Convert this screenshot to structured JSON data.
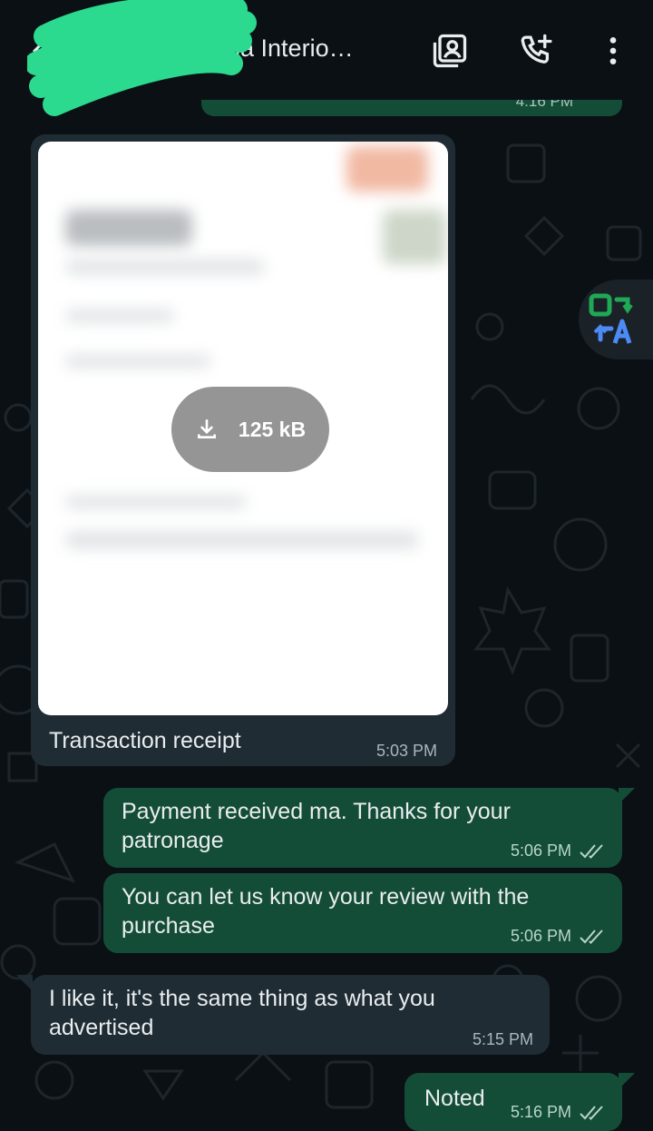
{
  "header": {
    "contact_name": "Adumma Interio…",
    "icons": [
      "back-arrow-icon",
      "contact-card-icon",
      "add-call-icon",
      "more-vert-icon"
    ]
  },
  "previous_message": {
    "time": "4:16 PM"
  },
  "messages": [
    {
      "direction": "incoming",
      "type": "document",
      "caption": "Transaction receipt",
      "file_size": "125 kB",
      "time": "5:03 PM"
    },
    {
      "direction": "outgoing",
      "text": "Payment received ma. Thanks for your patronage",
      "time": "5:06 PM",
      "status": "read"
    },
    {
      "direction": "outgoing",
      "text": "You can let us know your review with the purchase",
      "time": "5:06 PM",
      "status": "read"
    },
    {
      "direction": "incoming",
      "text": "I like it, it's the same thing as what you advertised",
      "time": "5:15 PM"
    },
    {
      "direction": "outgoing",
      "text": "Noted",
      "time": "5:16 PM",
      "status": "read"
    }
  ],
  "translate_button": {
    "icon": "translate-icon"
  },
  "colors": {
    "background": "#0b1014",
    "incoming_bubble": "#1f2c34",
    "outgoing_bubble": "#144d37",
    "text": "#e9edef",
    "read_ticks": "#b8d6c9",
    "translate_green": "#1fa855",
    "translate_blue": "#4c8bf5"
  }
}
